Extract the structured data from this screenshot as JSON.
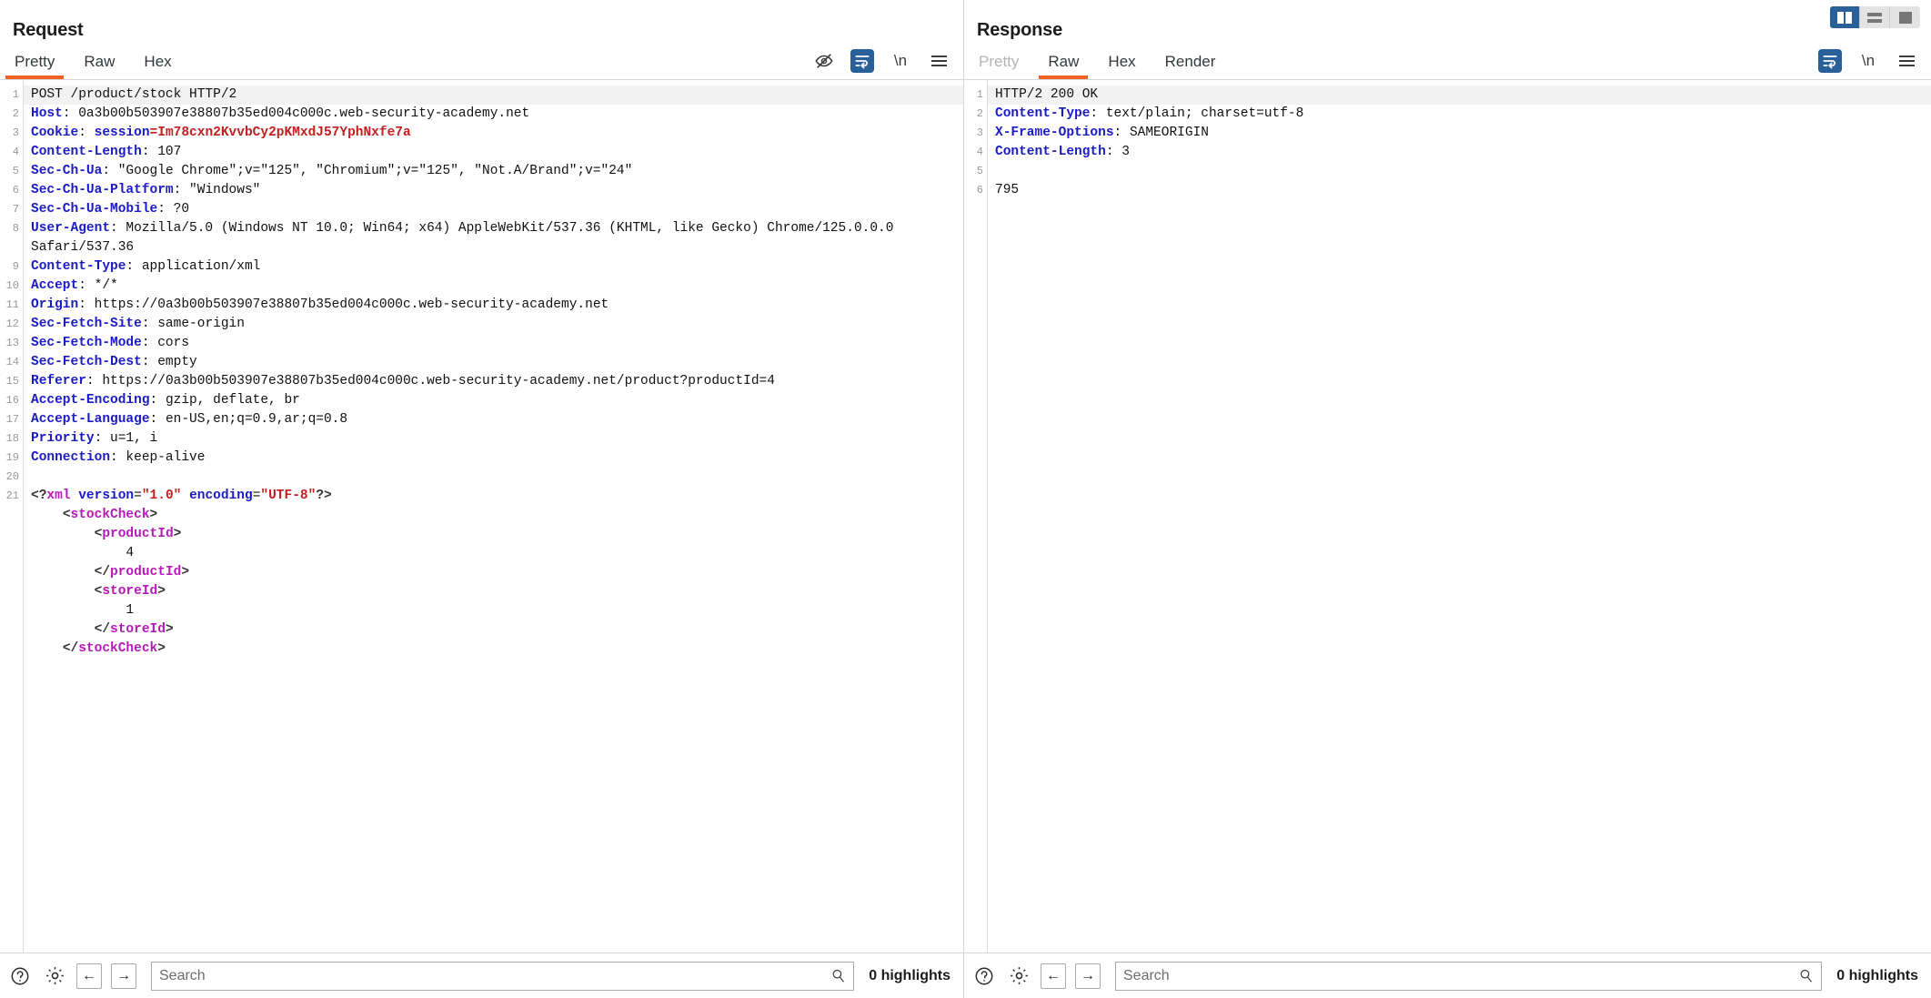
{
  "layout_toggle": {
    "buttons": [
      {
        "name": "vertical-split",
        "label": "Vertical split",
        "active": true
      },
      {
        "name": "horizontal-split",
        "label": "Horizontal split",
        "active": false
      },
      {
        "name": "single-pane",
        "label": "Single pane",
        "active": false
      }
    ]
  },
  "request": {
    "title": "Request",
    "tabs": [
      {
        "label": "Pretty",
        "active": true,
        "disabled": false
      },
      {
        "label": "Raw",
        "active": false,
        "disabled": false
      },
      {
        "label": "Hex",
        "active": false,
        "disabled": false
      }
    ],
    "tool_icons": [
      {
        "name": "eye-off-icon",
        "label": "Ø",
        "active": false
      },
      {
        "name": "word-wrap-icon",
        "label": "↩",
        "active": true
      },
      {
        "name": "newline-icon",
        "label": "\\n",
        "active": false
      },
      {
        "name": "menu-icon",
        "label": "☰",
        "active": false
      }
    ],
    "line_numbers": [
      "1",
      "2",
      "3",
      "4",
      "5",
      "6",
      "7",
      "8",
      "",
      "9",
      "10",
      "11",
      "12",
      "13",
      "14",
      "15",
      "16",
      "17",
      "18",
      "19",
      "20",
      "21"
    ],
    "request_line": "POST /product/stock HTTP/2",
    "headers": [
      {
        "name": "Host",
        "value": "0a3b00b503907e38807b35ed004c000c.web-security-academy.net"
      },
      {
        "name": "Cookie",
        "cookie_name": "session",
        "cookie_value": "Im78cxn2KvvbCy2pKMxdJ57YphNxfe7a"
      },
      {
        "name": "Content-Length",
        "value": "107"
      },
      {
        "name": "Sec-Ch-Ua",
        "value": "\"Google Chrome\";v=\"125\", \"Chromium\";v=\"125\", \"Not.A/Brand\";v=\"24\""
      },
      {
        "name": "Sec-Ch-Ua-Platform",
        "value": "\"Windows\""
      },
      {
        "name": "Sec-Ch-Ua-Mobile",
        "value": "?0"
      },
      {
        "name": "User-Agent",
        "value": "Mozilla/5.0 (Windows NT 10.0; Win64; x64) AppleWebKit/537.36 (KHTML, like Gecko) Chrome/125.0.0.0 Safari/537.36"
      },
      {
        "name": "Content-Type",
        "value": "application/xml"
      },
      {
        "name": "Accept",
        "value": "*/*"
      },
      {
        "name": "Origin",
        "value": "https://0a3b00b503907e38807b35ed004c000c.web-security-academy.net"
      },
      {
        "name": "Sec-Fetch-Site",
        "value": "same-origin"
      },
      {
        "name": "Sec-Fetch-Mode",
        "value": "cors"
      },
      {
        "name": "Sec-Fetch-Dest",
        "value": "empty"
      },
      {
        "name": "Referer",
        "value": "https://0a3b00b503907e38807b35ed004c000c.web-security-academy.net/product?productId=4"
      },
      {
        "name": "Accept-Encoding",
        "value": "gzip, deflate, br"
      },
      {
        "name": "Accept-Language",
        "value": "en-US,en;q=0.9,ar;q=0.8"
      },
      {
        "name": "Priority",
        "value": "u=1, i"
      },
      {
        "name": "Connection",
        "value": "keep-alive"
      }
    ],
    "body_xml": {
      "declaration": {
        "prefix": "<?xml",
        "attrs": [
          {
            "name": "version",
            "value": "\"1.0\""
          },
          {
            "name": "encoding",
            "value": "\"UTF-8\""
          }
        ],
        "suffix": "?>"
      },
      "lines": [
        {
          "indent": 1,
          "type": "open",
          "tag": "stockCheck"
        },
        {
          "indent": 2,
          "type": "open",
          "tag": "productId"
        },
        {
          "indent": 3,
          "type": "text",
          "text": "4"
        },
        {
          "indent": 2,
          "type": "close",
          "tag": "productId"
        },
        {
          "indent": 2,
          "type": "open",
          "tag": "storeId"
        },
        {
          "indent": 3,
          "type": "text",
          "text": "1"
        },
        {
          "indent": 2,
          "type": "close",
          "tag": "storeId"
        },
        {
          "indent": 1,
          "type": "close",
          "tag": "stockCheck"
        }
      ]
    },
    "bottom": {
      "help_label": "?",
      "settings_label": "gear",
      "prev_label": "←",
      "next_label": "→",
      "search_placeholder": "Search",
      "search_value": "",
      "highlights": "0 highlights"
    }
  },
  "response": {
    "title": "Response",
    "tabs": [
      {
        "label": "Pretty",
        "active": false,
        "disabled": true
      },
      {
        "label": "Raw",
        "active": true,
        "disabled": false
      },
      {
        "label": "Hex",
        "active": false,
        "disabled": false
      },
      {
        "label": "Render",
        "active": false,
        "disabled": false
      }
    ],
    "tool_icons": [
      {
        "name": "word-wrap-icon",
        "label": "↩",
        "active": true
      },
      {
        "name": "newline-icon",
        "label": "\\n",
        "active": false
      },
      {
        "name": "menu-icon",
        "label": "☰",
        "active": false
      }
    ],
    "line_numbers": [
      "1",
      "2",
      "3",
      "4",
      "5",
      "6"
    ],
    "status_line": "HTTP/2 200 OK",
    "headers": [
      {
        "name": "Content-Type",
        "value": "text/plain; charset=utf-8"
      },
      {
        "name": "X-Frame-Options",
        "value": "SAMEORIGIN"
      },
      {
        "name": "Content-Length",
        "value": "3"
      }
    ],
    "blank_line": "",
    "body": "795",
    "bottom": {
      "help_label": "?",
      "settings_label": "gear",
      "prev_label": "←",
      "next_label": "→",
      "search_placeholder": "Search",
      "search_value": "",
      "highlights": "0 highlights"
    }
  },
  "colors": {
    "accent_orange": "#f26321",
    "accent_blue": "#2a6099",
    "header_name": "#1b1bc4",
    "cookie_value": "#c02020",
    "xml_tag": "#b61ab6"
  }
}
